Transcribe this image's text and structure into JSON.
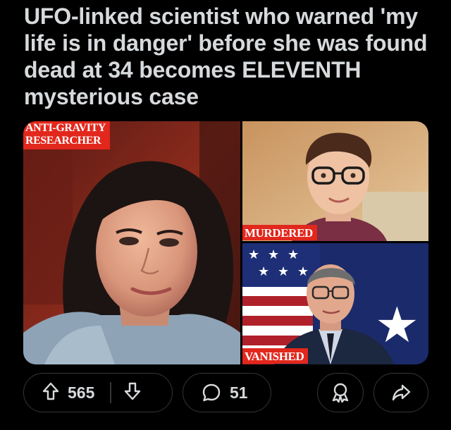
{
  "post": {
    "headline": "UFO-linked scientist who warned 'my life is in danger' before she was found dead at 34 becomes ELEVENTH mysterious case"
  },
  "media": {
    "captions": {
      "left_line1": "ANTI-GRAVITY",
      "left_line2": "RESEARCHER",
      "top_right": "MURDERED",
      "bottom_right": "VANISHED"
    }
  },
  "actions": {
    "upvote_count": "565",
    "comment_count": "51",
    "icons": {
      "upvote": "arrow-up-icon",
      "downvote": "arrow-down-icon",
      "comment": "speech-bubble-icon",
      "award": "award-ribbon-icon",
      "share": "share-arrow-icon"
    }
  },
  "colors": {
    "background": "#000000",
    "text": "#d7dadc",
    "caption_red": "#e2271c",
    "pill_border": "#343536"
  }
}
